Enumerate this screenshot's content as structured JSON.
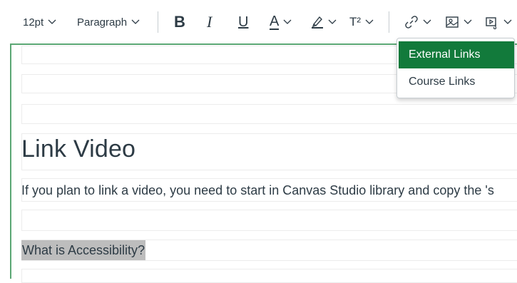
{
  "toolbar": {
    "font_size": "12pt",
    "block_format": "Paragraph",
    "bold_label": "B",
    "italic_label": "I",
    "underline_label": "U",
    "font_color_label": "A",
    "superscript_label": "T²"
  },
  "link_menu": {
    "items": [
      {
        "label": "External Links",
        "active": true
      },
      {
        "label": "Course Links",
        "active": false
      }
    ]
  },
  "content": {
    "heading": "Link Video",
    "body": "If you plan to link a video, you need to start in Canvas Studio library and copy the 's",
    "highlighted": "What is Accessibility?"
  },
  "colors": {
    "menu_active_bg": "#127a3b",
    "editor_focus_border": "#5ba774",
    "highlight_bg": "#bdbdbd",
    "text": "#2d3b45"
  }
}
